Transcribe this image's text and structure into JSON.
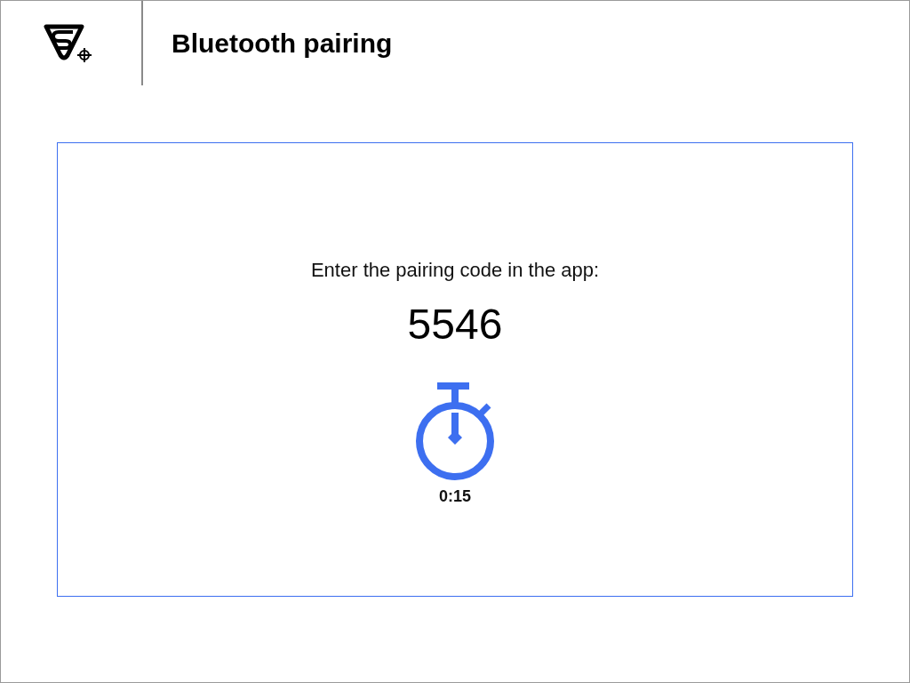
{
  "header": {
    "title": "Bluetooth pairing"
  },
  "panel": {
    "instruction": "Enter the pairing code in the app:",
    "code": "5546",
    "timer": "0:15"
  }
}
